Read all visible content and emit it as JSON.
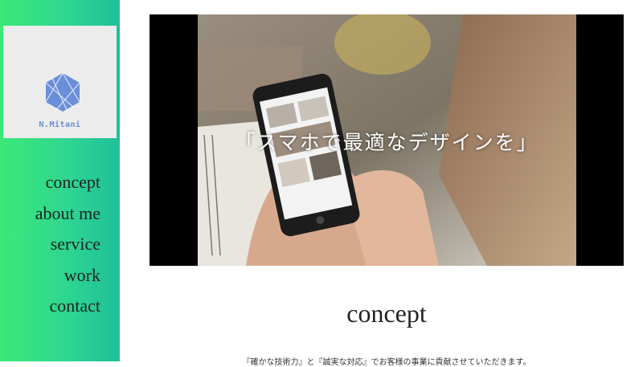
{
  "brand": {
    "name": "N.Mitani",
    "logo_color": "#6a8fd8"
  },
  "nav": {
    "items": [
      {
        "label": "concept"
      },
      {
        "label": "about me"
      },
      {
        "label": "service"
      },
      {
        "label": "work"
      },
      {
        "label": "contact"
      }
    ]
  },
  "hero": {
    "caption": "「スマホで最適なデザインを」"
  },
  "section": {
    "title": "concept",
    "partial_text": "『確かな技術力』と『誠実な対応』でお客様の事業に貢献させていただきます。"
  },
  "colors": {
    "sidebar_start": "#3be878",
    "sidebar_end": "#1fbf9a"
  }
}
